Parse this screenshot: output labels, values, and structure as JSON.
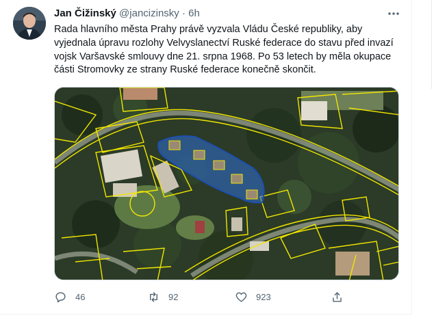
{
  "tweet": {
    "author_name": "Jan Čižinský",
    "author_handle": "@jancizinsky",
    "separator": "·",
    "time": "6h",
    "text": "Rada hlavního města Prahy právě vyzvala Vládu České republiky, aby vyjednala úpravu rozlohy Velvyslanectví Ruské federace do stavu před invazí vojsk Varšavské smlouvy dne 21. srpna 1968. Po 53 letech by měla okupace části Stromovky ze strany Ruské federace konečně skončit.",
    "text_lines": [
      "Rada hlavního města Prahy právě vyzvala Vládu České republiky, aby",
      "vyjednala úpravu rozlohy Velvyslanectví Ruské federace do stavu před invazí",
      "vojsk Varšavské smlouvy dne 21. srpna 1968. Po 53 letech by měla okupace",
      "části Stromovky ze strany Ruské federace konečně skončit."
    ],
    "media_type": "aerial cadastral map with highlighted area"
  },
  "actions": {
    "reply_count": "46",
    "retweet_count": "92",
    "like_count": "923",
    "icons": [
      "reply-icon",
      "retweet-icon",
      "like-icon",
      "share-icon"
    ]
  },
  "colors": {
    "text_primary": "#0f1419",
    "text_secondary": "#536471",
    "map_parcel_lines": "#f2e600",
    "highlight_fill": "#2f6fd6",
    "highlight_stroke": "#1d4fb0"
  }
}
